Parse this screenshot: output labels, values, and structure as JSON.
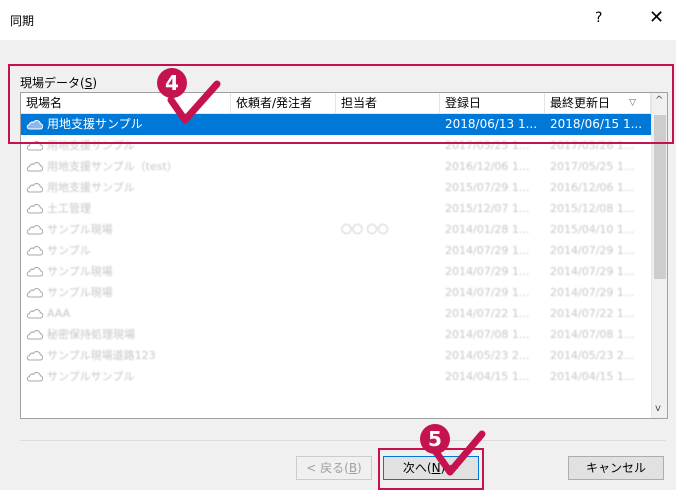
{
  "window": {
    "title": "同期",
    "help_label": "?",
    "close_label": "✕"
  },
  "group": {
    "label": "現場データ(",
    "accel": "S",
    "label_end": ")"
  },
  "table": {
    "headers": [
      "現場名",
      "依頼者/発注者",
      "担当者",
      "登録日",
      "最終更新日"
    ],
    "sort_glyph": "▽",
    "rows": [
      {
        "name": "用地支援サンプル",
        "client": "",
        "person": "",
        "registered": "2018/06/13 1...",
        "updated": "2018/06/15 1...",
        "selected": true
      },
      {
        "name": "用地支援サンプル",
        "client": "",
        "person": "",
        "registered": "2017/05/25 1...",
        "updated": "2017/05/26 1..."
      },
      {
        "name": "用地支援サンプル（test）",
        "client": "",
        "person": "",
        "registered": "2016/12/06 1...",
        "updated": "2017/05/25 1..."
      },
      {
        "name": "用地支援サンプル",
        "client": "",
        "person": "",
        "registered": "2015/07/29 1...",
        "updated": "2016/12/06 1..."
      },
      {
        "name": "土工管理",
        "client": "",
        "person": "",
        "registered": "2015/12/07 1...",
        "updated": "2015/12/08 1..."
      },
      {
        "name": "サンプル現場",
        "client": "",
        "person": "〇〇 〇〇",
        "registered": "2014/01/28 1...",
        "updated": "2015/04/10 1..."
      },
      {
        "name": "サンプル",
        "client": "",
        "person": "",
        "registered": "2014/07/29 1...",
        "updated": "2014/07/29 1..."
      },
      {
        "name": "サンプル現場",
        "client": "",
        "person": "",
        "registered": "2014/07/29 1...",
        "updated": "2014/07/29 1..."
      },
      {
        "name": "サンプル現場",
        "client": "",
        "person": "",
        "registered": "2014/07/29 1...",
        "updated": "2014/07/29 1..."
      },
      {
        "name": "AAA",
        "client": "",
        "person": "",
        "registered": "2014/07/22 1...",
        "updated": "2014/07/22 1..."
      },
      {
        "name": "秘密保持処理現場",
        "client": "",
        "person": "",
        "registered": "2014/07/08 1...",
        "updated": "2014/07/08 1..."
      },
      {
        "name": "サンプル現場道路123",
        "client": "",
        "person": "",
        "registered": "2014/05/23 2...",
        "updated": "2014/05/23 2..."
      },
      {
        "name": "サンプルサンプル",
        "client": "",
        "person": "",
        "registered": "2014/04/15 1...",
        "updated": "2014/04/15 1..."
      }
    ]
  },
  "scrollbar": {
    "up": "^",
    "down": "v"
  },
  "buttons": {
    "back_label": "< 戻る(",
    "back_accel": "B",
    "back_end": ")",
    "next_label": "次へ(",
    "next_accel": "N",
    "next_end": ") >",
    "cancel_label": "キャンセル"
  },
  "callouts": {
    "step4": "4",
    "step5": "5",
    "color": "#c4134f"
  },
  "colors": {
    "selection": "#0078d7",
    "dialog_bg": "#f0f0f0"
  }
}
